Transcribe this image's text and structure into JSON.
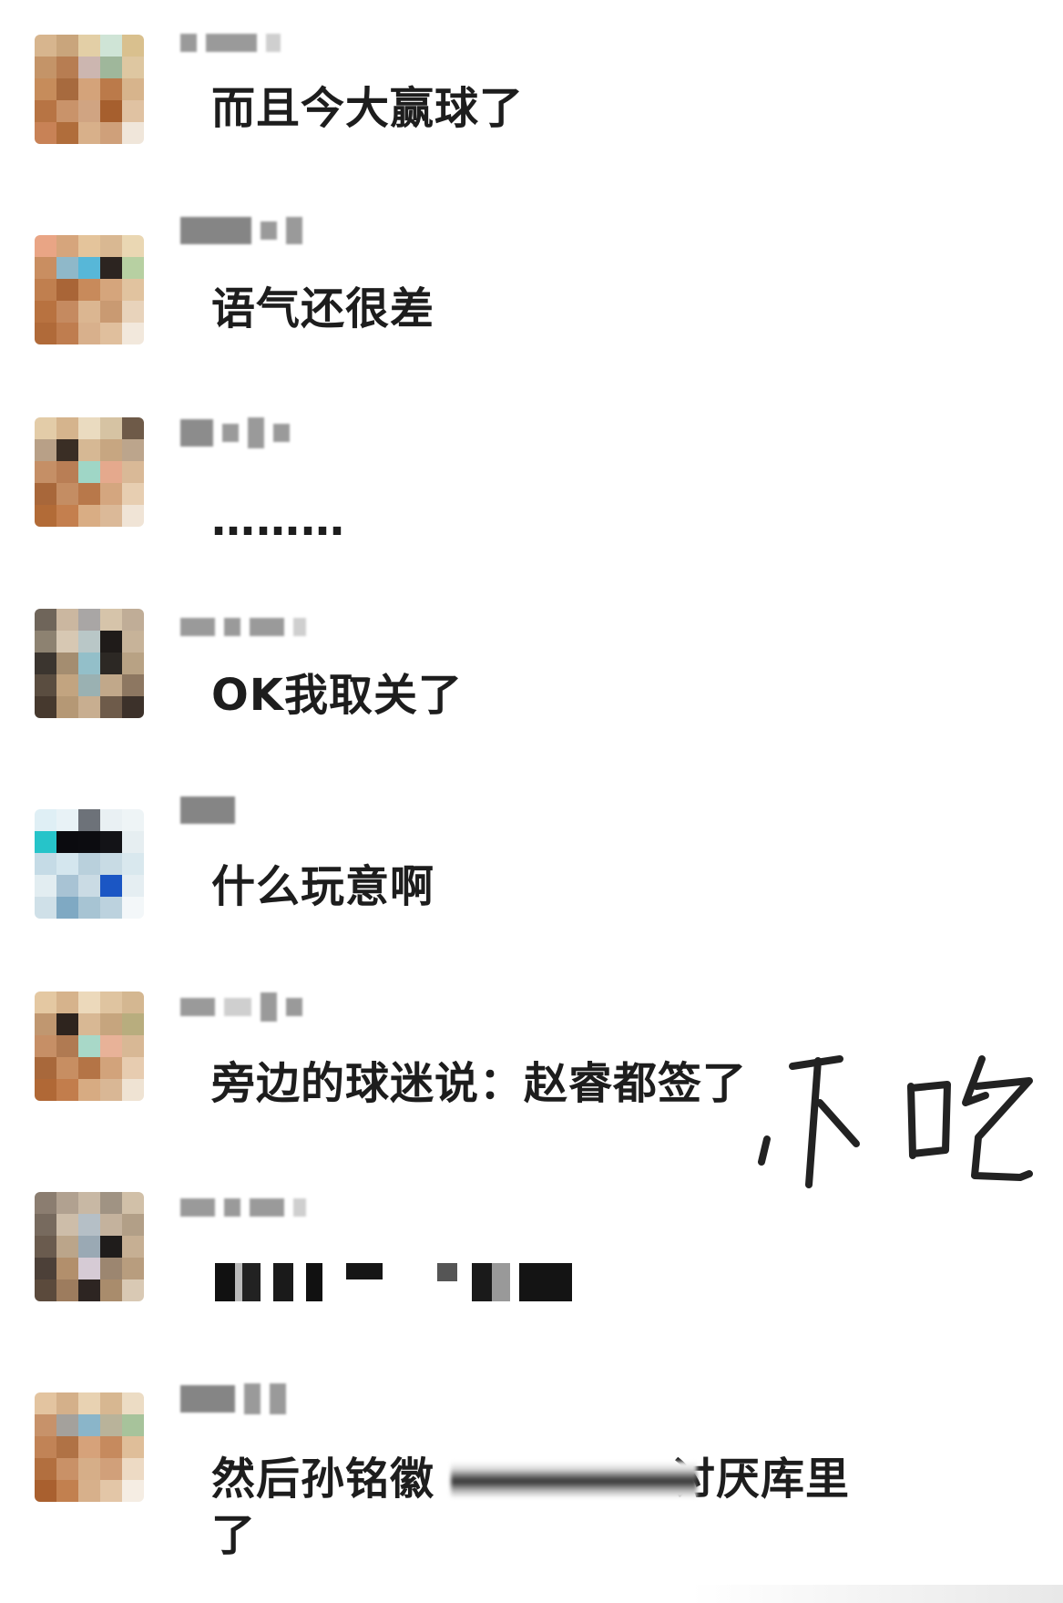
{
  "messages": [
    {
      "text": "而且今大赢球了"
    },
    {
      "text": "语气还很差"
    },
    {
      "text": "………"
    },
    {
      "text": "OK我取关了"
    },
    {
      "text": "什么玩意啊"
    },
    {
      "text": "旁边的球迷说：赵睿都签了"
    },
    {
      "text": ""
    },
    {
      "text_before": "然后孙铭徽",
      "text_after": "讨厌库里",
      "text_line2": "了"
    }
  ],
  "handwritten_note": "不吃",
  "colors": {
    "background": "#ffffff",
    "text": "#1d1d1d",
    "redaction": "#9a9a9a"
  }
}
